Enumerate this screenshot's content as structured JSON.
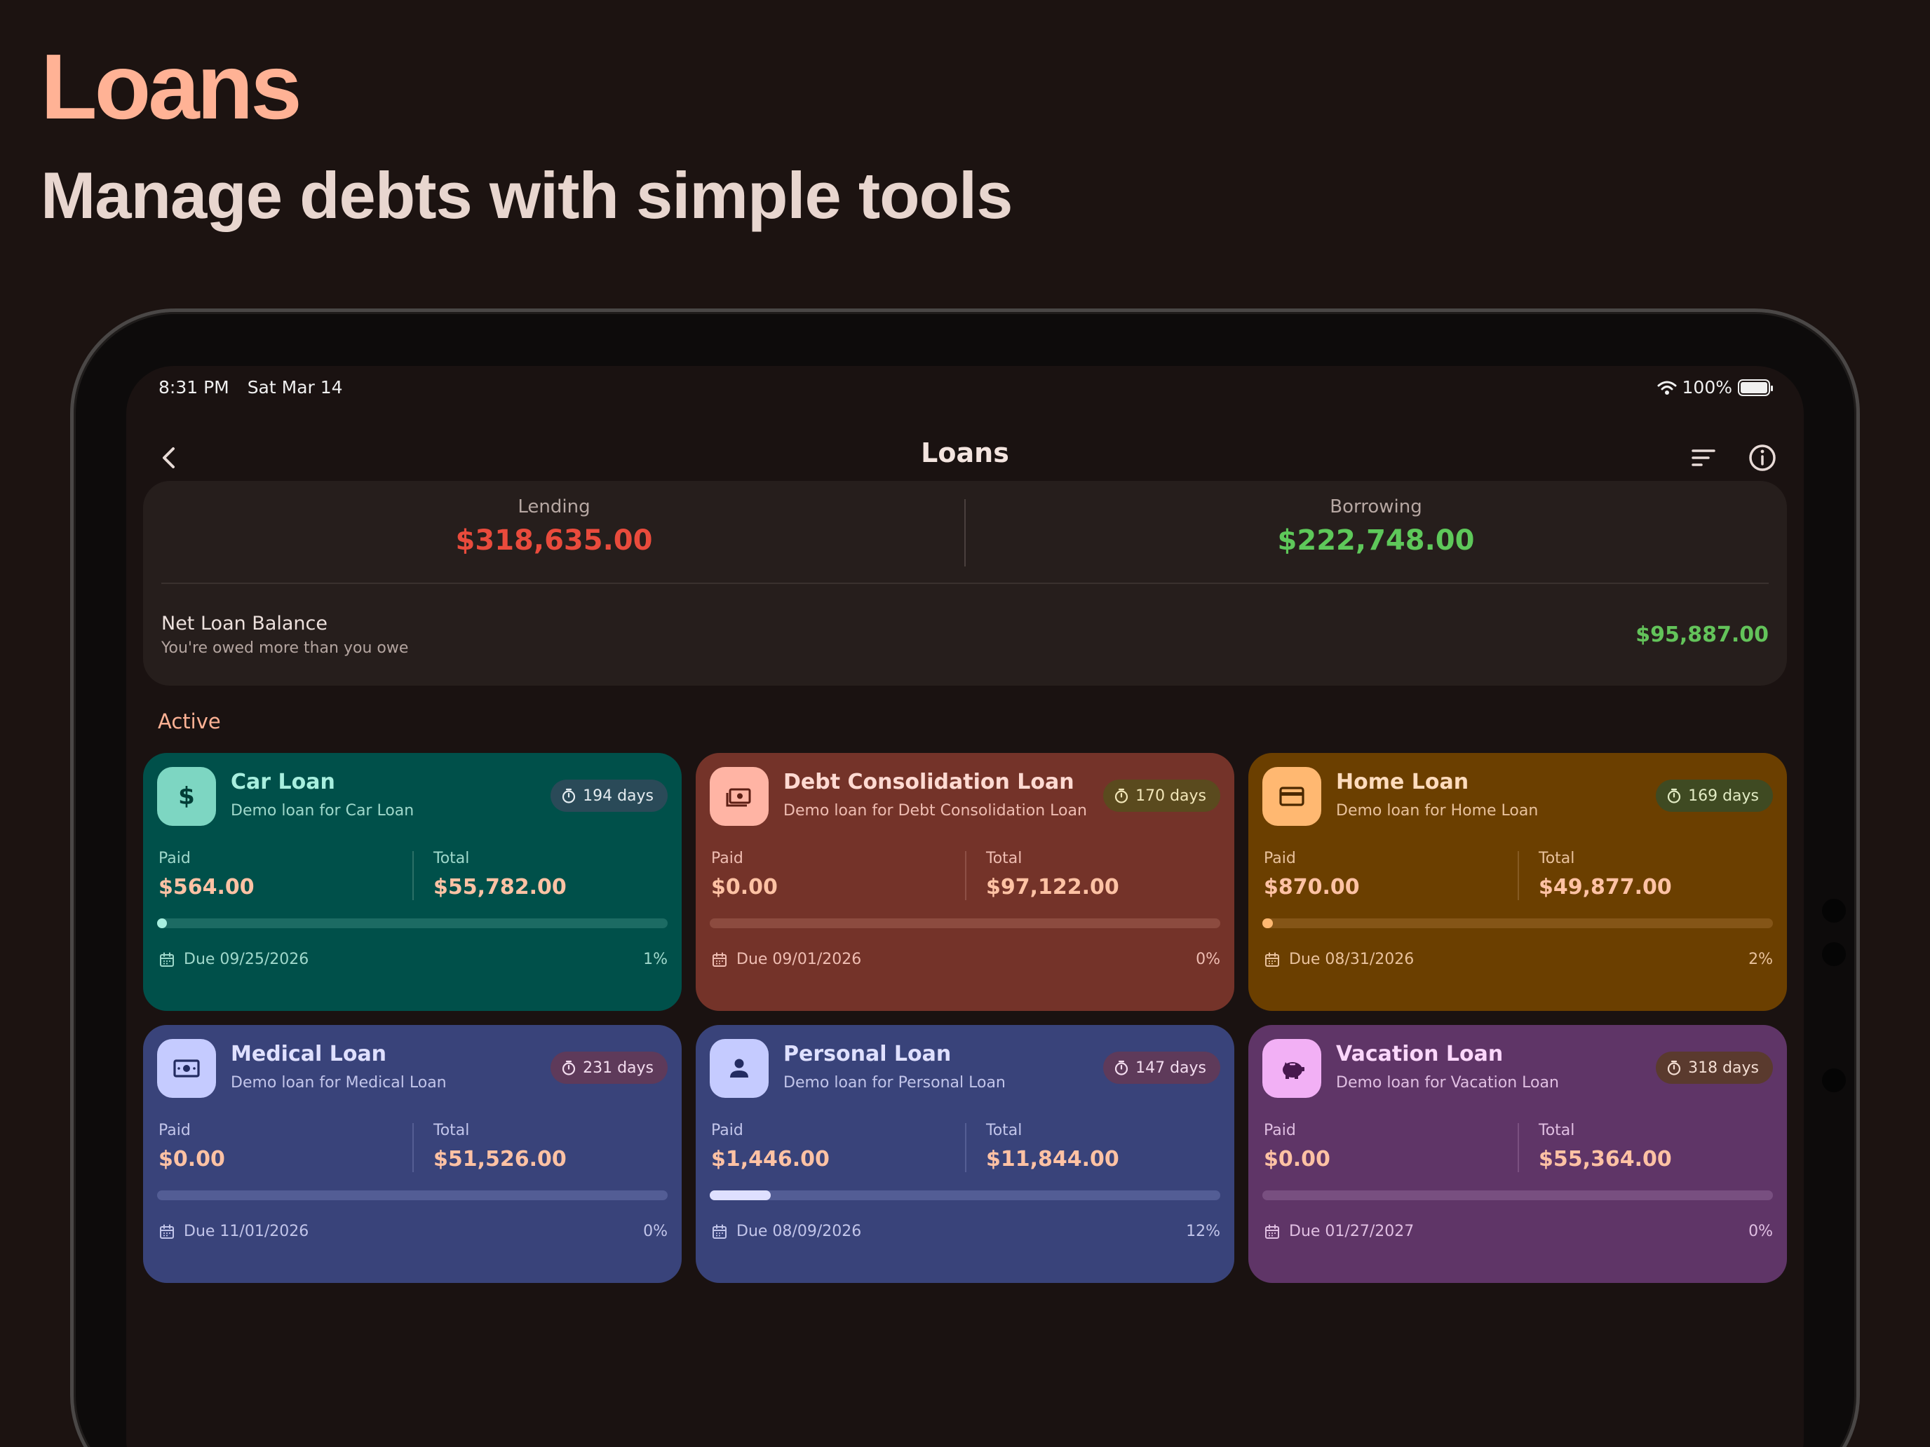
{
  "promo": {
    "title": "Loans",
    "subtitle": "Manage debts with simple tools"
  },
  "status_bar": {
    "time": "8:31 PM",
    "date": "Sat Mar 14",
    "battery": "100%",
    "wifi_icon": "wifi-icon",
    "battery_icon": "battery-icon"
  },
  "header": {
    "title": "Loans",
    "back_icon": "chevron-left-icon",
    "sort_icon": "sort-icon",
    "info_icon": "info-icon"
  },
  "summary": {
    "lending_label": "Lending",
    "lending_amount": "$318,635.00",
    "borrowing_label": "Borrowing",
    "borrowing_amount": "$222,748.00",
    "net_label": "Net Loan Balance",
    "net_sub": "You're owed more than you owe",
    "net_amount": "$95,887.00",
    "colors": {
      "lending": "#e94b3c",
      "borrowing": "#5ec85a",
      "net": "#63c35a"
    }
  },
  "section_title": "Active",
  "loans": [
    {
      "name": "Car Loan",
      "desc": "Demo loan for Car Loan",
      "days": "194 days",
      "paid_label": "Paid",
      "paid": "$564.00",
      "total_label": "Total",
      "total": "$55,782.00",
      "due": "Due 09/25/2026",
      "percent": "1%",
      "progress": 0.01,
      "icon": "dollar-icon",
      "colors": {
        "bg": "#00504a",
        "icon_bg": "#7dd6c2",
        "icon_fg": "#003d36",
        "title": "#a8efdf",
        "text": "#9fd8cb",
        "chip": "#2a4a58",
        "chip_text": "#e4ecf0",
        "track": "#1c6b63",
        "fill": "#a8efdf",
        "value": "#ffc2a4",
        "divider": "#2c7067"
      }
    },
    {
      "name": "Debt Consolidation Loan",
      "desc": "Demo loan for Debt Consolidation Loan",
      "days": "170 days",
      "paid_label": "Paid",
      "paid": "$0.00",
      "total_label": "Total",
      "total": "$97,122.00",
      "due": "Due 09/01/2026",
      "percent": "0%",
      "progress": 0.0,
      "icon": "cash-icon",
      "colors": {
        "bg": "#743329",
        "icon_bg": "#ffb4a4",
        "icon_fg": "#5c1e14",
        "title": "#ffdad2",
        "text": "#efbdb2",
        "chip": "#5a4a1e",
        "chip_text": "#f2e6b8",
        "track": "#8c4b3f",
        "fill": "#ffdad2",
        "value": "#ffc2a4",
        "divider": "#8e5046"
      }
    },
    {
      "name": "Home Loan",
      "desc": "Demo loan for Home Loan",
      "days": "169 days",
      "paid_label": "Paid",
      "paid": "$870.00",
      "total_label": "Total",
      "total": "$49,877.00",
      "due": "Due 08/31/2026",
      "percent": "2%",
      "progress": 0.02,
      "icon": "card-icon",
      "colors": {
        "bg": "#6b3f00",
        "icon_bg": "#ffb871",
        "icon_fg": "#4a2800",
        "title": "#ffdcbd",
        "text": "#e9c29c",
        "chip": "#3f4a22",
        "chip_text": "#e2ebc4",
        "track": "#845517",
        "fill": "#ffb871",
        "value": "#ffc2a4",
        "divider": "#855a22"
      }
    },
    {
      "name": "Medical Loan",
      "desc": "Demo loan for Medical Loan",
      "days": "231 days",
      "paid_label": "Paid",
      "paid": "$0.00",
      "total_label": "Total",
      "total": "$51,526.00",
      "due": "Due 11/01/2026",
      "percent": "0%",
      "progress": 0.0,
      "icon": "banknote-icon",
      "colors": {
        "bg": "#39437a",
        "icon_bg": "#c5cbff",
        "icon_fg": "#232c61",
        "title": "#dfe0ff",
        "text": "#c2c5ea",
        "chip": "#5e3a5a",
        "chip_text": "#f3dcef",
        "track": "#535d95",
        "fill": "#dfe0ff",
        "value": "#ffc2a4",
        "divider": "#555e94"
      }
    },
    {
      "name": "Personal Loan",
      "desc": "Demo loan for Personal Loan",
      "days": "147 days",
      "paid_label": "Paid",
      "paid": "$1,446.00",
      "total_label": "Total",
      "total": "$11,844.00",
      "due": "Due 08/09/2026",
      "percent": "12%",
      "progress": 0.12,
      "icon": "person-icon",
      "colors": {
        "bg": "#39437a",
        "icon_bg": "#c5cbff",
        "icon_fg": "#232c61",
        "title": "#dfe0ff",
        "text": "#c2c5ea",
        "chip": "#5e3a5a",
        "chip_text": "#f3dcef",
        "track": "#535d95",
        "fill": "#dfe0ff",
        "value": "#ffc2a4",
        "divider": "#555e94"
      }
    },
    {
      "name": "Vacation Loan",
      "desc": "Demo loan for Vacation Loan",
      "days": "318 days",
      "paid_label": "Paid",
      "paid": "$0.00",
      "total_label": "Total",
      "total": "$55,364.00",
      "due": "Due 01/27/2027",
      "percent": "0%",
      "progress": 0.0,
      "icon": "piggy-bank-icon",
      "colors": {
        "bg": "#5f3567",
        "icon_bg": "#f2b0f5",
        "icon_fg": "#47184e",
        "title": "#fbd7fb",
        "text": "#e0bfe2",
        "chip": "#5a3a2e",
        "chip_text": "#f3ddd2",
        "track": "#784f80",
        "fill": "#fbd7fb",
        "value": "#ffc2a4",
        "divider": "#7a5080"
      }
    }
  ]
}
